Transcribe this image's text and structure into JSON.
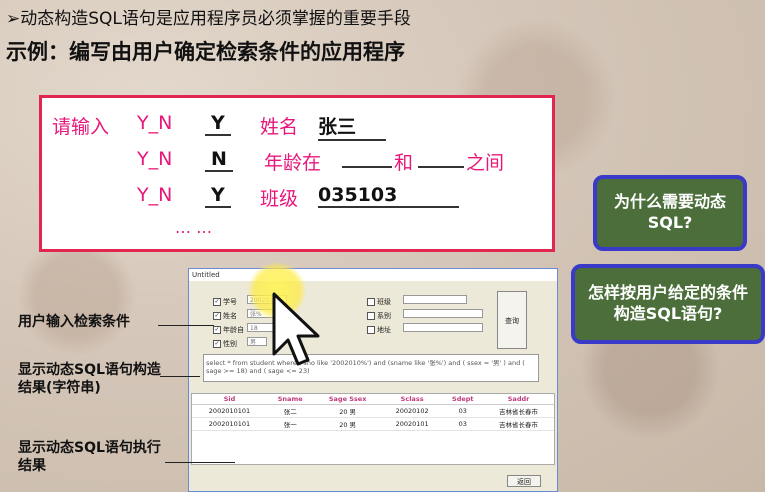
{
  "headline": "➢动态构造SQL语句是应用程序员必须掌握的重要手段",
  "subtitle": "示例：编写由用户确定检索条件的应用程序",
  "example_form": {
    "prompt": "请输入",
    "rows": [
      {
        "yn": "Y_N",
        "answer": "Y",
        "field": "姓名",
        "value": "张三",
        "blank": "___"
      },
      {
        "yn": "Y_N",
        "answer": "N",
        "field": "年龄在",
        "blank1": "____",
        "between": "和",
        "blank2": "____",
        "tail": "之间"
      },
      {
        "yn": "Y_N",
        "answer": "Y",
        "field": "班级",
        "value": "035103",
        "blank": "_____"
      }
    ],
    "ellipsis": "… …"
  },
  "questions": {
    "q1": "为什么需要动态SQL?",
    "q2": "怎样按用户给定的条件构造SQL语句?"
  },
  "labels": {
    "input": "用户输入检索条件",
    "sql_result": "显示动态SQL语句构造结果(字符串)",
    "exec_result": "显示动态SQL语句执行结果"
  },
  "window": {
    "title": "Untitled",
    "checkboxes": [
      {
        "label": "学号",
        "value": "2002010",
        "checked": "✓"
      },
      {
        "label": "姓名",
        "value": "张%",
        "checked": "✓"
      },
      {
        "label": "年龄自",
        "value": "18",
        "checked": "✓"
      },
      {
        "label": "性别",
        "value": "男",
        "checked": "✓"
      },
      {
        "label": "班级",
        "value": "",
        "checked": ""
      },
      {
        "label": "系别",
        "value": "",
        "checked": ""
      },
      {
        "label": "地址",
        "value": "",
        "checked": ""
      }
    ],
    "query_button": "查询",
    "sql_text": "select * from student where ( sno like '2002010%') and  (sname like '张%') and ( ssex = '男' ) and ( sage >= 18) and ( sage <= 23)",
    "columns": [
      "Sid",
      "Sname",
      "Sage Ssex",
      "Sclass",
      "Sdept",
      "Saddr"
    ],
    "rows": [
      [
        "2002010101",
        "张二",
        "20 男",
        "20020102",
        "03",
        "吉林省长春市"
      ],
      [
        "2002010101",
        "张一",
        "20 男",
        "20020101",
        "03",
        "吉林省长春市"
      ]
    ],
    "return_button": "返回"
  }
}
